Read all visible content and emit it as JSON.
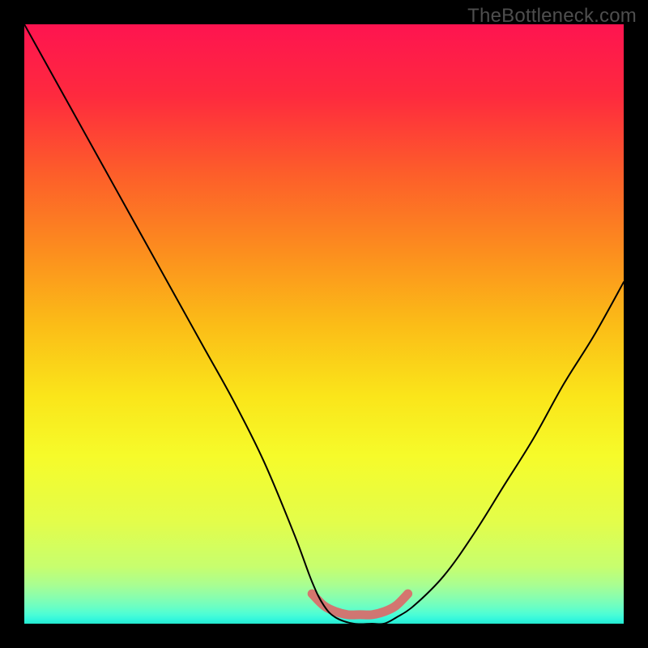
{
  "watermark": {
    "text": "TheBottleneck.com"
  },
  "chart_data": {
    "type": "line",
    "title": "",
    "xlabel": "",
    "ylabel": "",
    "xlim": [
      0,
      100
    ],
    "ylim": [
      0,
      100
    ],
    "series": [
      {
        "name": "curve",
        "x": [
          0,
          5,
          10,
          15,
          20,
          25,
          30,
          35,
          40,
          45,
          48,
          50,
          52,
          55,
          58,
          60,
          62,
          65,
          70,
          75,
          80,
          85,
          90,
          95,
          100
        ],
        "y": [
          100,
          91,
          82,
          73,
          64,
          55,
          46,
          37,
          27,
          15,
          7,
          3,
          1,
          0,
          0,
          0,
          1,
          3,
          8,
          15,
          23,
          31,
          40,
          48,
          57
        ]
      },
      {
        "name": "accent-band",
        "x": [
          48,
          50,
          52,
          54,
          56,
          58,
          60,
          62,
          64
        ],
        "y": [
          5,
          3,
          2,
          1.5,
          1.5,
          1.5,
          2,
          3,
          5
        ]
      }
    ],
    "gradient_bands": [
      {
        "stop": 0.0,
        "color": "#fe1450"
      },
      {
        "stop": 0.12,
        "color": "#fe2a3e"
      },
      {
        "stop": 0.25,
        "color": "#fd5e2a"
      },
      {
        "stop": 0.38,
        "color": "#fc8e1e"
      },
      {
        "stop": 0.5,
        "color": "#fbbc17"
      },
      {
        "stop": 0.62,
        "color": "#fae51a"
      },
      {
        "stop": 0.72,
        "color": "#f6fb2a"
      },
      {
        "stop": 0.83,
        "color": "#e3fd4a"
      },
      {
        "stop": 0.905,
        "color": "#c7fe6e"
      },
      {
        "stop": 0.935,
        "color": "#a9fe91"
      },
      {
        "stop": 0.955,
        "color": "#8afead"
      },
      {
        "stop": 0.972,
        "color": "#6afec4"
      },
      {
        "stop": 0.985,
        "color": "#4bfdd6"
      },
      {
        "stop": 0.993,
        "color": "#33f7dc"
      },
      {
        "stop": 1.0,
        "color": "#24e7cd"
      }
    ],
    "accent_color": "#db6a69",
    "curve_color": "#000000"
  }
}
